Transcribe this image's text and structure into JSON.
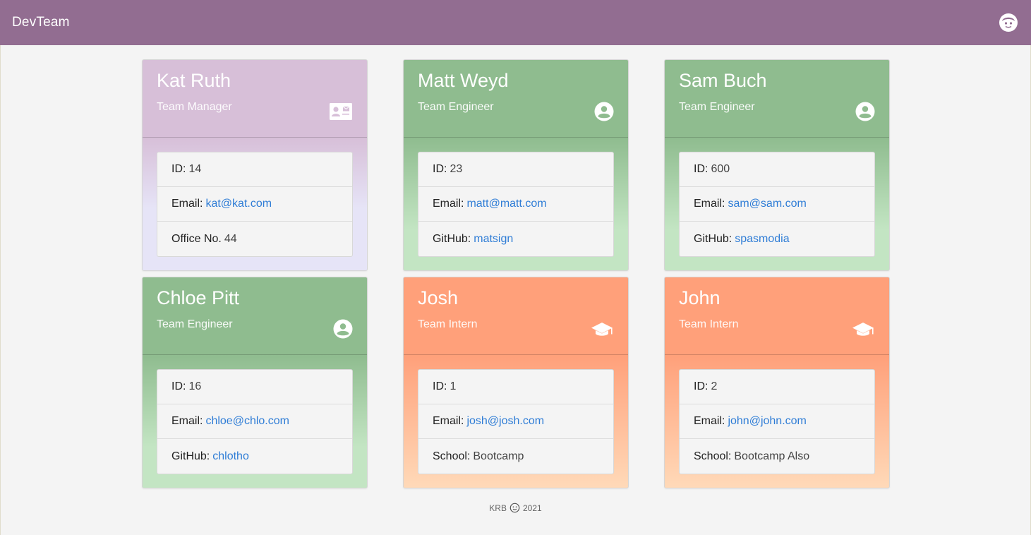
{
  "navbar": {
    "brand": "DevTeam",
    "logo_icon": "face-icon"
  },
  "colors": {
    "navbar": "#926d91",
    "manager": "#d7bfd8",
    "engineer": "#8fbc8f",
    "intern": "#ffa07a",
    "link": "#2f7dd6"
  },
  "cards": [
    {
      "name": "Kat Ruth",
      "role": "Team Manager",
      "icon": "contact-card-icon",
      "id_label": "ID:",
      "id": "14",
      "email_label": "Email:",
      "email": "kat@kat.com",
      "extra_label": "Office No.",
      "extra": "44"
    },
    {
      "name": "Matt Weyd",
      "role": "Team Engineer",
      "icon": "account-circle-icon",
      "id_label": "ID:",
      "id": "23",
      "email_label": "Email:",
      "email": "matt@matt.com",
      "extra_label": "GitHub:",
      "extra": "matsign"
    },
    {
      "name": "Sam Buch",
      "role": "Team Engineer",
      "icon": "account-circle-icon",
      "id_label": "ID:",
      "id": "600",
      "email_label": "Email:",
      "email": "sam@sam.com",
      "extra_label": "GitHub:",
      "extra": "spasmodia"
    },
    {
      "name": "Chloe Pitt",
      "role": "Team Engineer",
      "icon": "account-circle-icon",
      "id_label": "ID:",
      "id": "16",
      "email_label": "Email:",
      "email": "chloe@chlo.com",
      "extra_label": "GitHub:",
      "extra": "chlotho"
    },
    {
      "name": "Josh",
      "role": "Team Intern",
      "icon": "graduation-cap-icon",
      "id_label": "ID:",
      "id": "1",
      "email_label": "Email:",
      "email": "josh@josh.com",
      "extra_label": "School:",
      "extra": "Bootcamp"
    },
    {
      "name": "John",
      "role": "Team Intern",
      "icon": "graduation-cap-icon",
      "id_label": "ID:",
      "id": "2",
      "email_label": "Email:",
      "email": "john@john.com",
      "extra_label": "School:",
      "extra": "Bootcamp Also"
    }
  ],
  "footer": {
    "author": "KRB",
    "icon": "smiley-icon",
    "year": "2021"
  }
}
